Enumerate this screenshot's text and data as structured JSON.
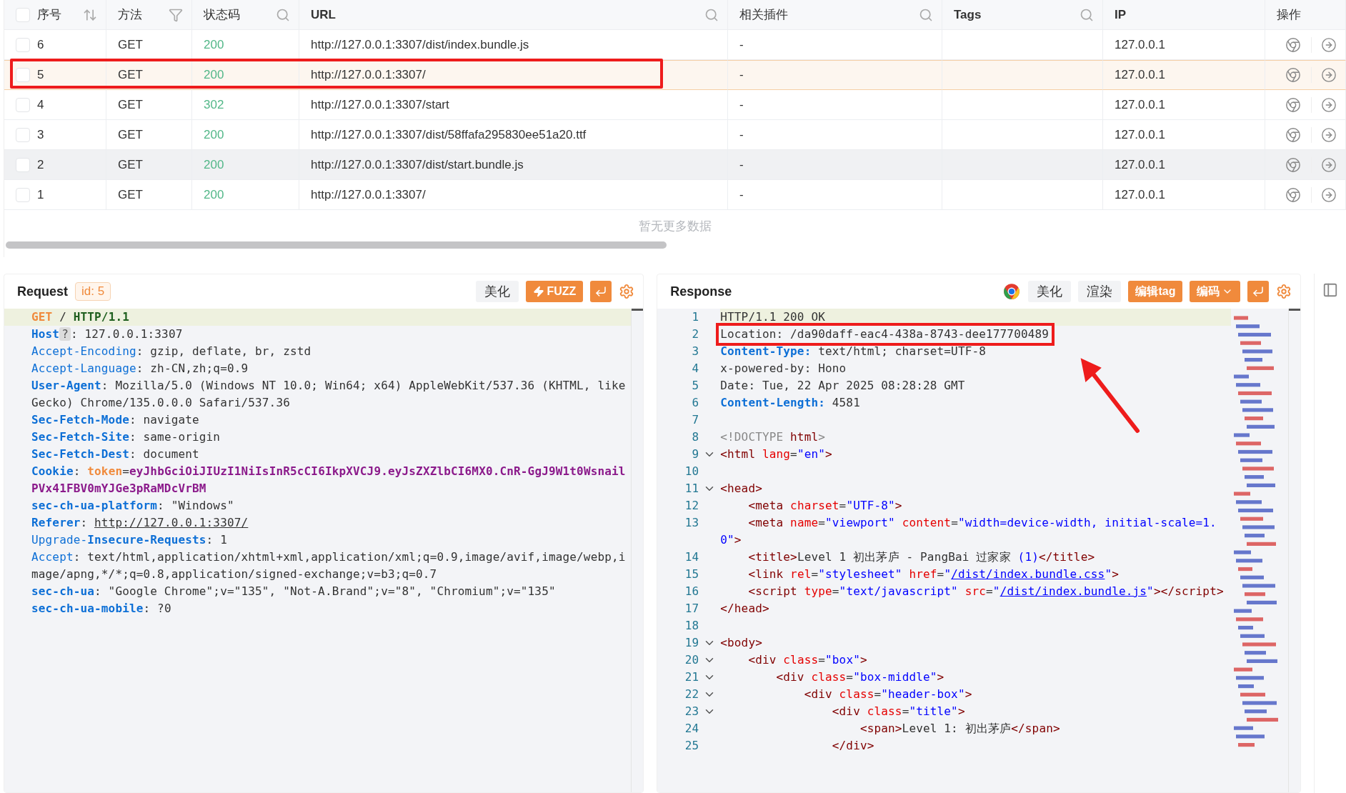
{
  "table": {
    "header_checkbox": {
      "checked": false
    },
    "columns": [
      {
        "label": "序号",
        "kind": "sort"
      },
      {
        "label": "方法",
        "kind": "filter"
      },
      {
        "label": "状态码",
        "kind": "search"
      },
      {
        "label": "URL",
        "kind": "search"
      },
      {
        "label": "相关插件",
        "kind": "search"
      },
      {
        "label": "Tags",
        "kind": "search"
      },
      {
        "label": "IP",
        "kind": "plain"
      },
      {
        "label": "操作",
        "kind": "plain"
      }
    ],
    "rows": [
      {
        "id": "6",
        "method": "GET",
        "status": "200",
        "url": "http://127.0.0.1:3307/dist/index.bundle.js",
        "plugin": "-",
        "ip": "127.0.0.1",
        "checked": false,
        "selected": false,
        "hovered": false,
        "highlighted": false
      },
      {
        "id": "5",
        "method": "GET",
        "status": "200",
        "url": "http://127.0.0.1:3307/",
        "plugin": "-",
        "ip": "127.0.0.1",
        "checked": false,
        "selected": true,
        "hovered": false,
        "highlighted": true
      },
      {
        "id": "4",
        "method": "GET",
        "status": "302",
        "url": "http://127.0.0.1:3307/start",
        "plugin": "-",
        "ip": "127.0.0.1",
        "checked": false,
        "selected": false,
        "hovered": false,
        "highlighted": false
      },
      {
        "id": "3",
        "method": "GET",
        "status": "200",
        "url": "http://127.0.0.1:3307/dist/58ffafa295830ee51a20.ttf",
        "plugin": "-",
        "ip": "127.0.0.1",
        "checked": false,
        "selected": false,
        "hovered": false,
        "highlighted": false
      },
      {
        "id": "2",
        "method": "GET",
        "status": "200",
        "url": "http://127.0.0.1:3307/dist/start.bundle.js",
        "plugin": "-",
        "ip": "127.0.0.1",
        "checked": false,
        "selected": false,
        "hovered": true,
        "highlighted": false
      },
      {
        "id": "1",
        "method": "GET",
        "status": "200",
        "url": "http://127.0.0.1:3307/",
        "plugin": "-",
        "ip": "127.0.0.1",
        "checked": false,
        "selected": false,
        "hovered": false,
        "highlighted": false
      }
    ],
    "footer": "暂无更多数据"
  },
  "request": {
    "title": "Request",
    "id_badge": "id: 5",
    "buttons": [
      {
        "kind": "plain",
        "label": "美化"
      },
      {
        "kind": "fuzz",
        "label": "FUZZ"
      },
      {
        "kind": "wrap"
      },
      {
        "kind": "settings"
      }
    ],
    "lines": [
      {
        "active": true,
        "segments": [
          {
            "kind": "method",
            "text": "GET"
          },
          {
            "kind": "text",
            "text": " / "
          },
          {
            "kind": "version",
            "text": "HTTP/1.1"
          }
        ]
      },
      {
        "active": false,
        "segments": [
          {
            "kind": "key",
            "text": "Host"
          },
          {
            "kind": "badge",
            "text": "?"
          },
          {
            "kind": "text",
            "text": ": 127.0.0.1:3307"
          }
        ]
      },
      {
        "active": false,
        "segments": [
          {
            "kind": "key-light",
            "text": "Accept-Encoding"
          },
          {
            "kind": "text",
            "text": ": gzip, deflate, br, zstd"
          }
        ]
      },
      {
        "active": false,
        "segments": [
          {
            "kind": "key-light",
            "text": "Accept-Language"
          },
          {
            "kind": "text",
            "text": ": zh-CN,zh;q=0.9"
          }
        ]
      },
      {
        "active": false,
        "segments": [
          {
            "kind": "key",
            "text": "User-Agent"
          },
          {
            "kind": "text",
            "text": ": Mozilla/5.0 (Windows NT 10.0; Win64; x64) AppleWebKit/537.36 (KHTML, like Gecko) Chrome/135.0.0.0 Safari/537.36"
          }
        ]
      },
      {
        "active": false,
        "segments": [
          {
            "kind": "key",
            "text": "Sec-Fetch-Mode"
          },
          {
            "kind": "text",
            "text": ": navigate"
          }
        ]
      },
      {
        "active": false,
        "segments": [
          {
            "kind": "key",
            "text": "Sec-Fetch-Site"
          },
          {
            "kind": "text",
            "text": ": same-origin"
          }
        ]
      },
      {
        "active": false,
        "segments": [
          {
            "kind": "key",
            "text": "Sec-Fetch-Dest"
          },
          {
            "kind": "text",
            "text": ": document"
          }
        ]
      },
      {
        "active": false,
        "segments": [
          {
            "kind": "key",
            "text": "Cookie"
          },
          {
            "kind": "text",
            "text": ": "
          },
          {
            "kind": "cookie-name",
            "text": "token"
          },
          {
            "kind": "text",
            "text": "="
          },
          {
            "kind": "cookie-value",
            "text": "eyJhbGciOiJIUzI1NiIsInR5cCI6IkpXVCJ9.eyJsZXZlbCI6MX0.CnR-GgJ9W1t0WsnailPVx41FBV0mYJGe3pRaMDcVrBM"
          }
        ]
      },
      {
        "active": false,
        "segments": [
          {
            "kind": "key",
            "text": "sec-ch-ua-platform"
          },
          {
            "kind": "text",
            "text": ": \"Windows\""
          }
        ]
      },
      {
        "active": false,
        "segments": [
          {
            "kind": "key",
            "text": "Referer"
          },
          {
            "kind": "text",
            "text": ": "
          },
          {
            "kind": "link",
            "text": "http://127.0.0.1:3307/"
          }
        ]
      },
      {
        "active": false,
        "segments": [
          {
            "kind": "key-light",
            "text": "Upgrade-"
          },
          {
            "kind": "key",
            "text": "Insecure-Requests"
          },
          {
            "kind": "text",
            "text": ": 1"
          }
        ]
      },
      {
        "active": false,
        "segments": [
          {
            "kind": "key-light",
            "text": "Accept"
          },
          {
            "kind": "text",
            "text": ": text/html,application/xhtml+xml,application/xml;q=0.9,image/avif,image/webp,image/apng,*/*;q=0.8,application/signed-exchange;v=b3;q=0.7"
          }
        ]
      },
      {
        "active": false,
        "segments": [
          {
            "kind": "key",
            "text": "sec-ch-ua"
          },
          {
            "kind": "text",
            "text": ": \"Google Chrome\";v=\"135\", \"Not-A.Brand\";v=\"8\", \"Chromium\";v=\"135\""
          }
        ]
      },
      {
        "active": false,
        "segments": [
          {
            "kind": "key",
            "text": "sec-ch-ua-mobile"
          },
          {
            "kind": "text",
            "text": ": ?0"
          }
        ]
      }
    ]
  },
  "response": {
    "title": "Response",
    "buttons": [
      {
        "kind": "browser"
      },
      {
        "kind": "plain",
        "label": "美化"
      },
      {
        "kind": "plain",
        "label": "渲染"
      },
      {
        "kind": "accent",
        "label": "编辑tag"
      },
      {
        "kind": "dropdown",
        "label": "编码"
      },
      {
        "kind": "wrap"
      },
      {
        "kind": "settings"
      }
    ],
    "lines": [
      {
        "number": "1",
        "active": true,
        "boxed": false,
        "segments": [
          {
            "kind": "text",
            "text": "HTTP/1.1 200 OK"
          }
        ]
      },
      {
        "number": "2",
        "active": false,
        "boxed": true,
        "segments": [
          {
            "kind": "text",
            "text": "Location: /da90daff-eac4-438a-8743-dee177700489"
          }
        ]
      },
      {
        "number": "3",
        "active": false,
        "boxed": false,
        "segments": [
          {
            "kind": "key",
            "text": "Content-Type:"
          },
          {
            "kind": "text",
            "text": " text/html; charset=UTF-8"
          }
        ]
      },
      {
        "number": "4",
        "active": false,
        "boxed": false,
        "segments": [
          {
            "kind": "text",
            "text": "x-powered-by: Hono"
          }
        ]
      },
      {
        "number": "5",
        "active": false,
        "boxed": false,
        "segments": [
          {
            "kind": "text",
            "text": "Date: Tue, 22 Apr 2025 08:28:28 GMT"
          }
        ]
      },
      {
        "number": "6",
        "active": false,
        "boxed": false,
        "segments": [
          {
            "kind": "key",
            "text": "Content-Length:"
          },
          {
            "kind": "text",
            "text": " 4581"
          }
        ]
      },
      {
        "number": "7"
      },
      {
        "number": "8",
        "active": false,
        "boxed": false,
        "segments": [
          {
            "kind": "muted",
            "text": "<!DOCTYPE"
          },
          {
            "kind": "tag",
            "text": " html"
          },
          {
            "kind": "muted",
            "text": ">"
          }
        ]
      },
      {
        "number": "9",
        "active": false,
        "boxed": false,
        "expanded": true,
        "segments": [
          {
            "kind": "tag",
            "text": "<html"
          },
          {
            "kind": "attr",
            "text": " lang"
          },
          {
            "kind": "text",
            "text": "="
          },
          {
            "kind": "string",
            "text": "\"en\""
          },
          {
            "kind": "tag",
            "text": ">"
          }
        ]
      },
      {
        "number": "10"
      },
      {
        "number": "11",
        "active": false,
        "boxed": false,
        "expanded": true,
        "segments": [
          {
            "kind": "tag",
            "text": "<head>"
          }
        ]
      },
      {
        "number": "12",
        "active": false,
        "boxed": false,
        "segments": [
          {
            "kind": "tag",
            "text": "    <meta"
          },
          {
            "kind": "attr",
            "text": " charset"
          },
          {
            "kind": "text",
            "text": "="
          },
          {
            "kind": "string",
            "text": "\"UTF-8\""
          },
          {
            "kind": "tag",
            "text": ">"
          }
        ]
      },
      {
        "number": "13",
        "active": false,
        "boxed": false,
        "segments": [
          {
            "kind": "tag",
            "text": "    <meta"
          },
          {
            "kind": "attr",
            "text": " name"
          },
          {
            "kind": "text",
            "text": "="
          },
          {
            "kind": "string",
            "text": "\"viewport\""
          },
          {
            "kind": "attr",
            "text": " content"
          },
          {
            "kind": "text",
            "text": "="
          },
          {
            "kind": "string",
            "text": "\"width=device-width, initial-scale=1.0\""
          },
          {
            "kind": "tag",
            "text": ">"
          }
        ]
      },
      {
        "number": "14",
        "active": false,
        "boxed": false,
        "segments": [
          {
            "kind": "tag",
            "text": "    <title>"
          },
          {
            "kind": "text",
            "text": "Level 1 初出茅庐 - PangBai 过家家 "
          },
          {
            "kind": "string",
            "text": "(1)"
          },
          {
            "kind": "tag",
            "text": "</title>"
          }
        ]
      },
      {
        "number": "15",
        "active": false,
        "boxed": false,
        "segments": [
          {
            "kind": "tag",
            "text": "    <link"
          },
          {
            "kind": "attr",
            "text": " rel"
          },
          {
            "kind": "text",
            "text": "="
          },
          {
            "kind": "string",
            "text": "\"stylesheet\""
          },
          {
            "kind": "attr",
            "text": " href"
          },
          {
            "kind": "text",
            "text": "="
          },
          {
            "kind": "string",
            "text": "\""
          },
          {
            "kind": "link",
            "text": "/dist/index.bundle.css"
          },
          {
            "kind": "string",
            "text": "\""
          },
          {
            "kind": "tag",
            "text": ">"
          }
        ]
      },
      {
        "number": "16",
        "active": false,
        "boxed": false,
        "segments": [
          {
            "kind": "tag",
            "text": "    <script"
          },
          {
            "kind": "attr",
            "text": " type"
          },
          {
            "kind": "text",
            "text": "="
          },
          {
            "kind": "string",
            "text": "\"text/javascript\""
          },
          {
            "kind": "attr",
            "text": " src"
          },
          {
            "kind": "text",
            "text": "="
          },
          {
            "kind": "string",
            "text": "\""
          },
          {
            "kind": "link",
            "text": "/dist/index.bundle.js"
          },
          {
            "kind": "string",
            "text": "\""
          },
          {
            "kind": "tag",
            "text": "></script>"
          }
        ]
      },
      {
        "number": "17",
        "active": false,
        "boxed": false,
        "segments": [
          {
            "kind": "tag",
            "text": "</head>"
          }
        ]
      },
      {
        "number": "18"
      },
      {
        "number": "19",
        "active": false,
        "boxed": false,
        "expanded": true,
        "segments": [
          {
            "kind": "tag",
            "text": "<body>"
          }
        ]
      },
      {
        "number": "20",
        "active": false,
        "boxed": false,
        "expanded": true,
        "segments": [
          {
            "kind": "tag",
            "text": "    <div"
          },
          {
            "kind": "attr",
            "text": " class"
          },
          {
            "kind": "text",
            "text": "="
          },
          {
            "kind": "string",
            "text": "\"box\""
          },
          {
            "kind": "tag",
            "text": ">"
          }
        ]
      },
      {
        "number": "21",
        "active": false,
        "boxed": false,
        "expanded": true,
        "segments": [
          {
            "kind": "tag",
            "text": "        <div"
          },
          {
            "kind": "attr",
            "text": " class"
          },
          {
            "kind": "text",
            "text": "="
          },
          {
            "kind": "string",
            "text": "\"box-middle\""
          },
          {
            "kind": "tag",
            "text": ">"
          }
        ]
      },
      {
        "number": "22",
        "active": false,
        "boxed": false,
        "expanded": true,
        "segments": [
          {
            "kind": "tag",
            "text": "            <div"
          },
          {
            "kind": "attr",
            "text": " class"
          },
          {
            "kind": "text",
            "text": "="
          },
          {
            "kind": "string",
            "text": "\"header-box\""
          },
          {
            "kind": "tag",
            "text": ">"
          }
        ]
      },
      {
        "number": "23",
        "active": false,
        "boxed": false,
        "expanded": true,
        "segments": [
          {
            "kind": "tag",
            "text": "                <div"
          },
          {
            "kind": "attr",
            "text": " class"
          },
          {
            "kind": "text",
            "text": "="
          },
          {
            "kind": "string",
            "text": "\"title\""
          },
          {
            "kind": "tag",
            "text": ">"
          }
        ]
      },
      {
        "number": "24",
        "active": false,
        "boxed": false,
        "segments": [
          {
            "kind": "tag",
            "text": "                    <span>"
          },
          {
            "kind": "text",
            "text": "Level 1: 初出茅庐"
          },
          {
            "kind": "tag",
            "text": "</span>"
          }
        ]
      },
      {
        "number": "25",
        "active": false,
        "boxed": false,
        "segments": [
          {
            "kind": "tag",
            "text": "                </div>"
          }
        ]
      }
    ]
  }
}
